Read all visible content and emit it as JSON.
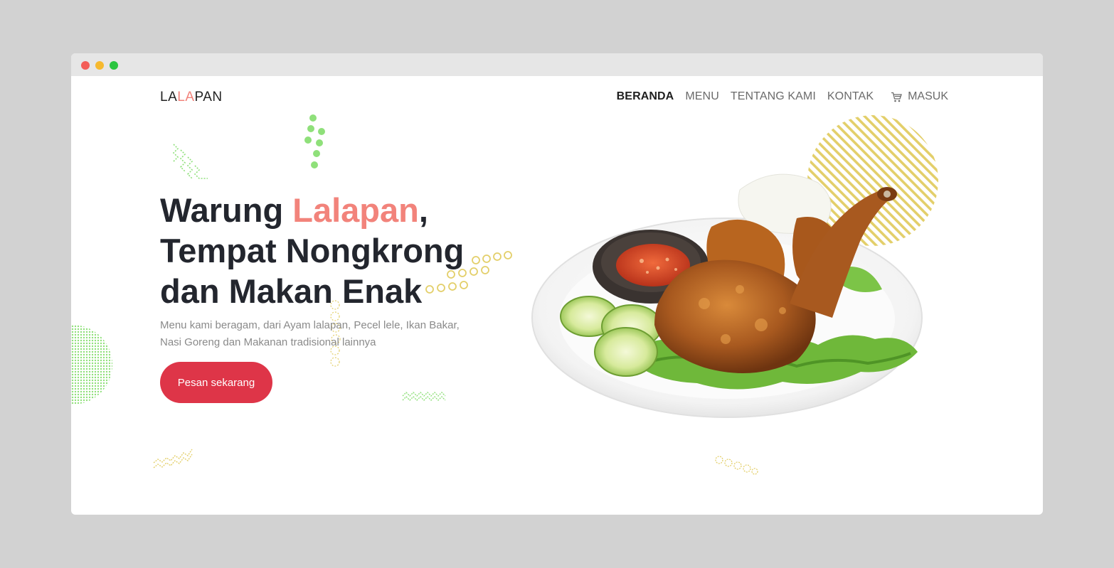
{
  "brand": {
    "part1": "LA",
    "part2": "LA",
    "part3": "PAN"
  },
  "nav": {
    "items": [
      "BERANDA",
      "MENU",
      "TENTANG KAMI",
      "KONTAK"
    ],
    "login_label": "MASUK"
  },
  "hero": {
    "title_part1": "Warung ",
    "title_highlight": "Lalapan",
    "title_part2": ",",
    "title_line2": "Tempat Nongkrong",
    "title_line3": "dan Makan Enak",
    "description": "Menu kami beragam, dari Ayam lalapan, Pecel lele, Ikan Bakar, Nasi Goreng dan Makanan tradisional lainnya",
    "cta_label": "Pesan sekarang"
  },
  "colors": {
    "accent": "#f2837b",
    "cta": "#de3548",
    "heading": "#23262e",
    "deco_green": "#8fe07a",
    "deco_yellow": "#e3cf6a"
  },
  "icons": [
    "cart-icon",
    "food-plate-image"
  ]
}
